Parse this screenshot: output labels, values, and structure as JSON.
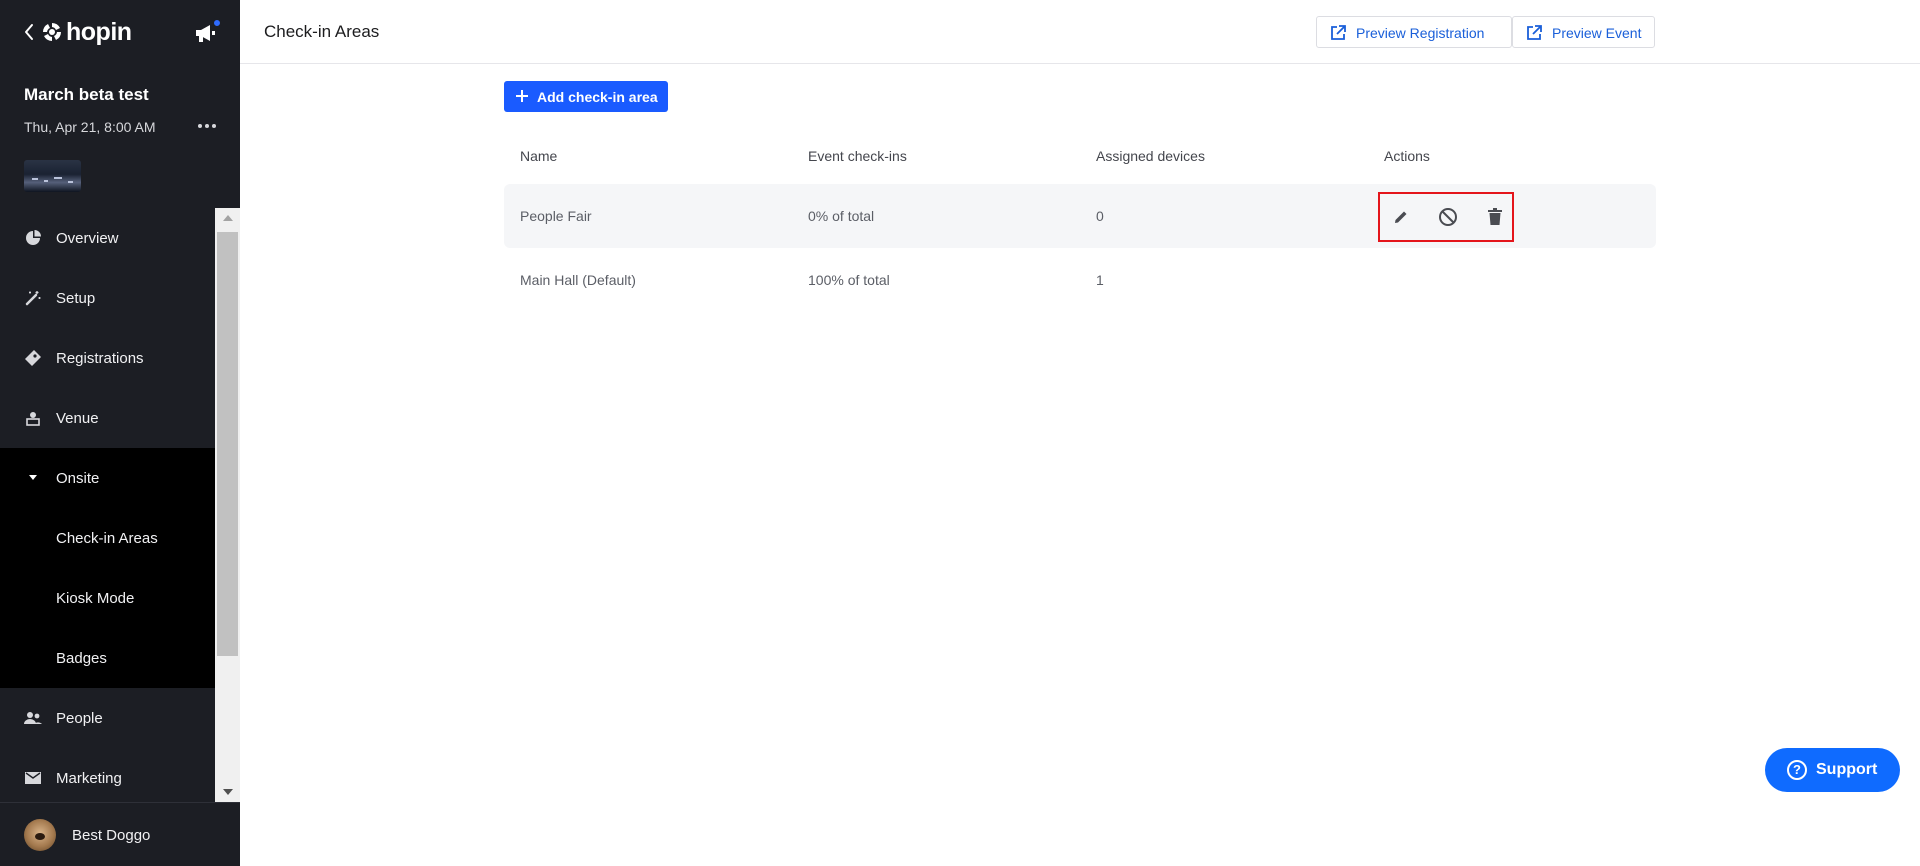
{
  "app": {
    "logo_text": "hopin"
  },
  "event": {
    "name": "March beta test",
    "date": "Thu, Apr 21, 8:00 AM"
  },
  "sidebar": {
    "items": [
      {
        "label": "Overview",
        "icon": "pie-chart-icon"
      },
      {
        "label": "Setup",
        "icon": "magic-wand-icon"
      },
      {
        "label": "Registrations",
        "icon": "ticket-icon"
      },
      {
        "label": "Venue",
        "icon": "venue-icon"
      },
      {
        "label": "Onsite",
        "icon": "caret-down-icon"
      },
      {
        "label": "Check-in Areas"
      },
      {
        "label": "Kiosk Mode"
      },
      {
        "label": "Badges"
      },
      {
        "label": "People",
        "icon": "people-icon"
      },
      {
        "label": "Marketing",
        "icon": "mail-icon"
      }
    ]
  },
  "user": {
    "name": "Best Doggo"
  },
  "header": {
    "title": "Check-in Areas",
    "preview_registration": "Preview Registration",
    "preview_event": "Preview Event"
  },
  "toolbar": {
    "add_label": "Add check-in area"
  },
  "table": {
    "columns": [
      "Name",
      "Event check-ins",
      "Assigned devices",
      "Actions"
    ],
    "rows": [
      {
        "name": "People Fair",
        "checkins": "0% of total",
        "devices": "0"
      },
      {
        "name": "Main Hall (Default)",
        "checkins": "100% of total",
        "devices": "1"
      }
    ]
  },
  "support": {
    "label": "Support"
  },
  "colors": {
    "primary": "#1a5bff",
    "sidebar_bg": "#1c1e24",
    "highlight": "#e4151b"
  }
}
